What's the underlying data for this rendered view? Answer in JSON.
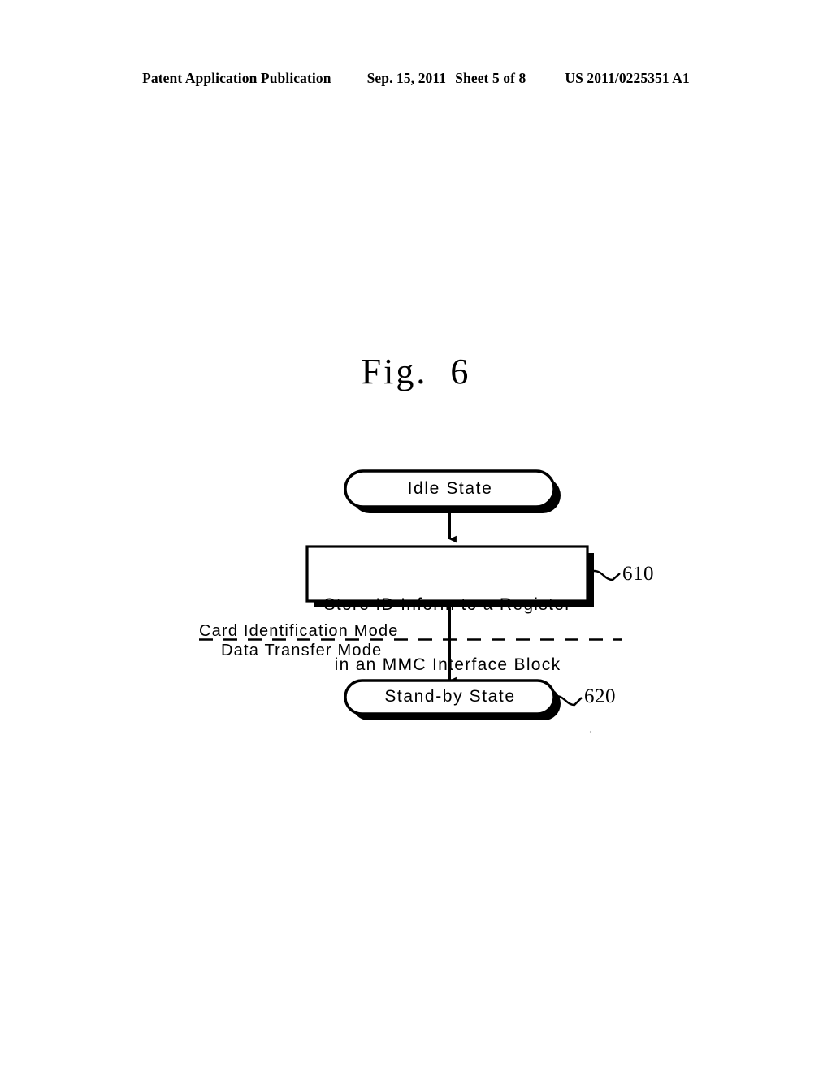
{
  "header": {
    "publication": "Patent Application Publication",
    "date": "Sep. 15, 2011",
    "sheet": "Sheet 5 of 8",
    "document_number": "US 2011/0225351 A1"
  },
  "figure": {
    "caption": "Fig.  6",
    "colors": {
      "stroke": "#000000",
      "background": "#ffffff",
      "shadow": "#000000"
    }
  },
  "diagram_data": {
    "type": "flowchart",
    "title": "Fig.  6",
    "orientation": "top-to-bottom",
    "nodes": [
      {
        "id": "idle-state",
        "label": "Idle State",
        "shape": "stadium",
        "reference": null
      },
      {
        "id": "store-id-inform",
        "label": "Store ID Inform to a Register\nin an MMC Interface Block",
        "line1": "Store ID Inform to a Register",
        "line2": "in an MMC Interface Block",
        "shape": "rectangle",
        "reference": "610"
      },
      {
        "id": "stand-by-state",
        "label": "Stand-by State",
        "shape": "stadium",
        "reference": "620"
      }
    ],
    "edges": [
      {
        "from": "idle-state",
        "to": "store-id-inform",
        "arrow": true
      },
      {
        "from": "store-id-inform",
        "to": "stand-by-state",
        "arrow": true
      }
    ],
    "divider": {
      "style": "dashed",
      "label_above": "Card Identification Mode",
      "label_below": "Data Transfer Mode"
    },
    "reference_numbers": [
      "610",
      "620"
    ]
  },
  "flowchart": {
    "idle_state": "Idle State",
    "process_line1": "Store ID Inform to a Register",
    "process_line2": "in an MMC Interface Block",
    "standby_state": "Stand-by State",
    "mode_above": "Card Identification Mode",
    "mode_below": "Data Transfer Mode",
    "ref_610": "610",
    "ref_620": "620"
  }
}
